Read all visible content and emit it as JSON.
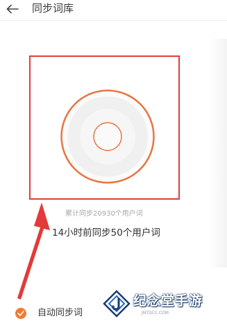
{
  "header": {
    "back_icon": "arrow-left-icon",
    "title": "同步词库"
  },
  "sync_panel": {
    "disc_icon": "sync-disc-icon",
    "total_text": "累计同步20930个用户词",
    "recent_text": "14小时前同步50个用户词"
  },
  "annotation": {
    "box_color": "#e33a3a",
    "arrow_color": "#e33a3a"
  },
  "settings": {
    "auto_sync_label": "自动同步词",
    "auto_sync_checked": true,
    "accent_color": "#ef7b34"
  },
  "watermark": {
    "name": "纪念堂手游",
    "url": "JNTDCC.COM"
  }
}
